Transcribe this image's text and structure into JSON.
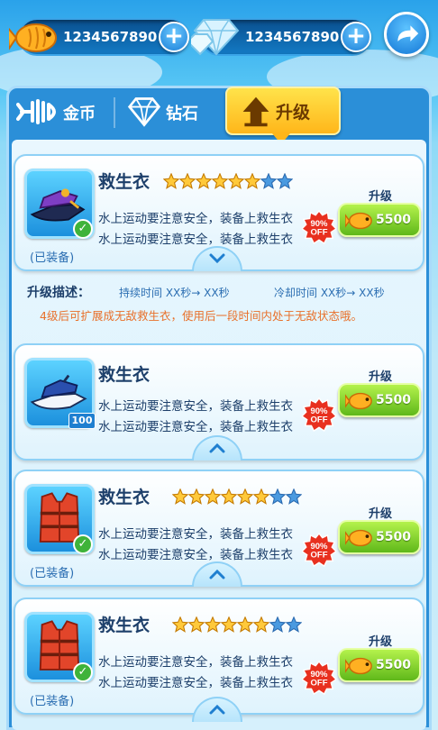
{
  "top_bar": {
    "gold_amount": "1234567890",
    "diamond_amount": "1234567890",
    "plus_label": "+"
  },
  "tabs": [
    {
      "label": "金币",
      "icon": "fish-bone-icon",
      "active": false
    },
    {
      "label": "钻石",
      "icon": "diamond-icon",
      "active": false
    },
    {
      "label": "升级",
      "icon": "upgrade-arrow-icon",
      "active": true
    }
  ],
  "items": [
    {
      "name": "救生衣",
      "thumb": "jetski-purple",
      "stars_filled": 6,
      "stars_total": 8,
      "desc_line1": "水上运动要注意安全，装备上救生衣",
      "desc_line2": "水上运动要注意安全，装备上救生衣",
      "status": "(已装备)",
      "upgrade_label": "升级",
      "price": "5500",
      "discount": "90% OFF",
      "expanded": true
    },
    {
      "name": "救生衣",
      "thumb": "jetski-blue",
      "level": "100",
      "desc_line1": "水上运动要注意安全，装备上救生衣",
      "desc_line2": "水上运动要注意安全，装备上救生衣",
      "upgrade_label": "升级",
      "price": "5500",
      "discount": "90% OFF",
      "expanded": false
    },
    {
      "name": "救生衣",
      "thumb": "life-vest",
      "stars_filled": 6,
      "stars_total": 8,
      "desc_line1": "水上运动要注意安全，装备上救生衣",
      "desc_line2": "水上运动要注意安全，装备上救生衣",
      "status": "(已装备)",
      "upgrade_label": "升级",
      "price": "5500",
      "discount": "90% OFF",
      "expanded": false
    },
    {
      "name": "救生衣",
      "thumb": "life-vest",
      "stars_filled": 6,
      "stars_total": 8,
      "desc_line1": "水上运动要注意安全，装备上救生衣",
      "desc_line2": "水上运动要注意安全，装备上救生衣",
      "status": "(已装备)",
      "upgrade_label": "升级",
      "price": "5500",
      "discount": "90% OFF",
      "expanded": false
    }
  ],
  "detail": {
    "title": "升级描述：",
    "duration": "持续时间 XX秒→ XX秒",
    "cooldown": "冷却时间 XX秒→ XX秒",
    "note": "4级后可扩展成无敌救生衣，使用后一段时间内处于无敌状态哦。"
  },
  "colors": {
    "panel_blue": "#2b8fd8",
    "tab_active": "#ffc21f",
    "buy_green": "#6cc21e",
    "note_orange": "#e8702a",
    "star_gold": "#ffc93a",
    "star_empty": "#4a9ae0"
  }
}
